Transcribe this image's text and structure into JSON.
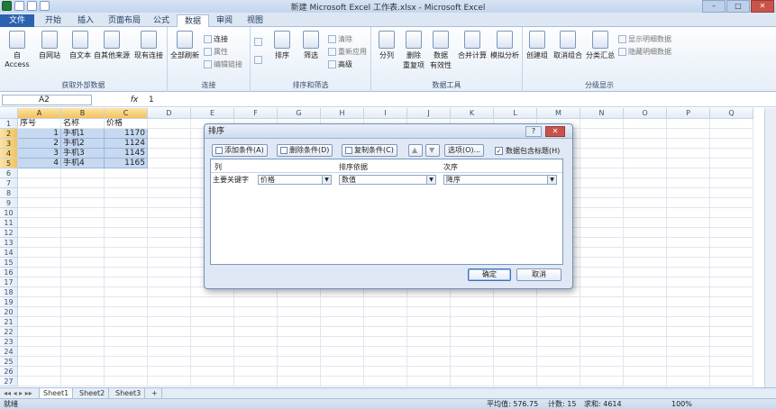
{
  "window": {
    "title": "新建 Microsoft Excel 工作表.xlsx - Microsoft Excel"
  },
  "tabs": [
    {
      "label": "文件"
    },
    {
      "label": "开始"
    },
    {
      "label": "插入"
    },
    {
      "label": "页面布局"
    },
    {
      "label": "公式"
    },
    {
      "label": "数据"
    },
    {
      "label": "审阅"
    },
    {
      "label": "视图"
    }
  ],
  "ribbon": {
    "g1": {
      "label": "获取外部数据",
      "b1": "自 Access",
      "b2": "自网站",
      "b3": "自文本",
      "b4": "自其他来源",
      "b5": "现有连接"
    },
    "g2": {
      "label": "连接",
      "b1": "全部刷新",
      "s1": "连接",
      "s2": "属性",
      "s3": "编辑链接"
    },
    "g3": {
      "label": "排序和筛选",
      "b1": "排序",
      "b2": "筛选",
      "s1": "清除",
      "s2": "重新应用",
      "s3": "高级"
    },
    "g4": {
      "label": "数据工具",
      "b1": "分列",
      "b2": "删除\n重复项",
      "b3": "数据\n有效性",
      "b4": "合并计算",
      "b5": "模拟分析"
    },
    "g5": {
      "label": "分级显示",
      "b1": "创建组",
      "b2": "取消组合",
      "b3": "分类汇总",
      "s1": "显示明细数据",
      "s2": "隐藏明细数据"
    }
  },
  "formula": {
    "namebox": "A2",
    "fx": "fx",
    "value": "1"
  },
  "columns": [
    "A",
    "B",
    "C",
    "D",
    "E",
    "F",
    "G",
    "H",
    "I",
    "J",
    "K",
    "L",
    "M",
    "N",
    "O",
    "P",
    "Q"
  ],
  "rows": [
    "1",
    "2",
    "3",
    "4",
    "5",
    "6",
    "7",
    "8",
    "9",
    "10",
    "11",
    "12",
    "13",
    "14",
    "15",
    "16",
    "17",
    "18",
    "19",
    "20",
    "21",
    "22",
    "23",
    "24",
    "25",
    "26",
    "27"
  ],
  "table": {
    "header": [
      "序号",
      "名称",
      "价格"
    ],
    "data": [
      [
        "1",
        "手机1",
        "1170"
      ],
      [
        "2",
        "手机2",
        "1124"
      ],
      [
        "3",
        "手机3",
        "1145"
      ],
      [
        "4",
        "手机4",
        "1165"
      ]
    ]
  },
  "sheets": [
    "Sheet1",
    "Sheet2",
    "Sheet3"
  ],
  "status": {
    "ready": "就绪",
    "avg": "平均值: 576.75",
    "count": "计数: 15",
    "sum": "求和: 4614",
    "zoom": "100%"
  },
  "dialog": {
    "title": "排序",
    "add": "添加条件(A)",
    "delete": "删除条件(D)",
    "copy": "复制条件(C)",
    "options": "选项(O)...",
    "has_header": "数据包含标题(H)",
    "col_head": "列",
    "basis_head": "排序依据",
    "order_head": "次序",
    "main_key": "主要关键字",
    "key_value": "价格",
    "basis_value": "数值",
    "order_value": "降序",
    "ok": "确定",
    "cancel": "取消"
  }
}
